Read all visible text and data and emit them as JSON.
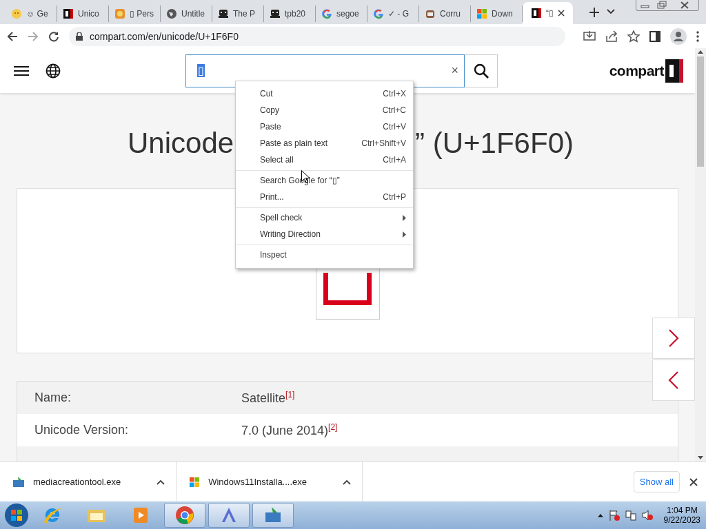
{
  "browser": {
    "tabs": [
      {
        "title": "☺ Ge",
        "selected": false
      },
      {
        "title": "Unico",
        "selected": false
      },
      {
        "title": "▯ Pers",
        "selected": false
      },
      {
        "title": "Untitle",
        "selected": false
      },
      {
        "title": "The P",
        "selected": false
      },
      {
        "title": "tpb20",
        "selected": false
      },
      {
        "title": "segoe",
        "selected": false
      },
      {
        "title": "✓ - G",
        "selected": false
      },
      {
        "title": "Corru",
        "selected": false
      },
      {
        "title": "Down",
        "selected": false
      },
      {
        "title": "“▯",
        "selected": true
      }
    ],
    "address": "compart.com/en/unicode/U+1F6F0"
  },
  "page": {
    "search": {
      "value": "▯",
      "clear": "×"
    },
    "logo": "compart",
    "title_start": "Unicode",
    "title_end": "” (U+1F6F0)",
    "properties": [
      {
        "label": "Name:",
        "value": "Satellite",
        "note": "[1]"
      },
      {
        "label": "Unicode Version:",
        "value": "7.0 (June 2014)",
        "note": "[2]"
      }
    ]
  },
  "context_menu": {
    "groups": [
      [
        {
          "label": "Cut",
          "shortcut": "Ctrl+X",
          "submenu": false
        },
        {
          "label": "Copy",
          "shortcut": "Ctrl+C",
          "submenu": false
        },
        {
          "label": "Paste",
          "shortcut": "Ctrl+V",
          "submenu": false
        },
        {
          "label": "Paste as plain text",
          "shortcut": "Ctrl+Shift+V",
          "submenu": false
        },
        {
          "label": "Select all",
          "shortcut": "Ctrl+A",
          "submenu": false
        }
      ],
      [
        {
          "label": "Search Google for “▯”",
          "submenu": false
        },
        {
          "label": "Print...",
          "shortcut": "Ctrl+P",
          "submenu": false
        }
      ],
      [
        {
          "label": "Spell check",
          "submenu": true
        },
        {
          "label": "Writing Direction",
          "submenu": true
        }
      ],
      [
        {
          "label": "Inspect",
          "submenu": false
        }
      ]
    ]
  },
  "downloads": {
    "items": [
      {
        "name": "mediacreationtool.exe"
      },
      {
        "name": "Windows11Installa....exe"
      }
    ],
    "show_all": "Show all"
  },
  "taskbar": {
    "apps": [
      {
        "selected": false
      },
      {
        "selected": false
      },
      {
        "selected": false
      },
      {
        "selected": true
      },
      {
        "selected": true
      },
      {
        "selected": true
      }
    ],
    "time": "1:04 PM",
    "date": "9/22/2023"
  }
}
